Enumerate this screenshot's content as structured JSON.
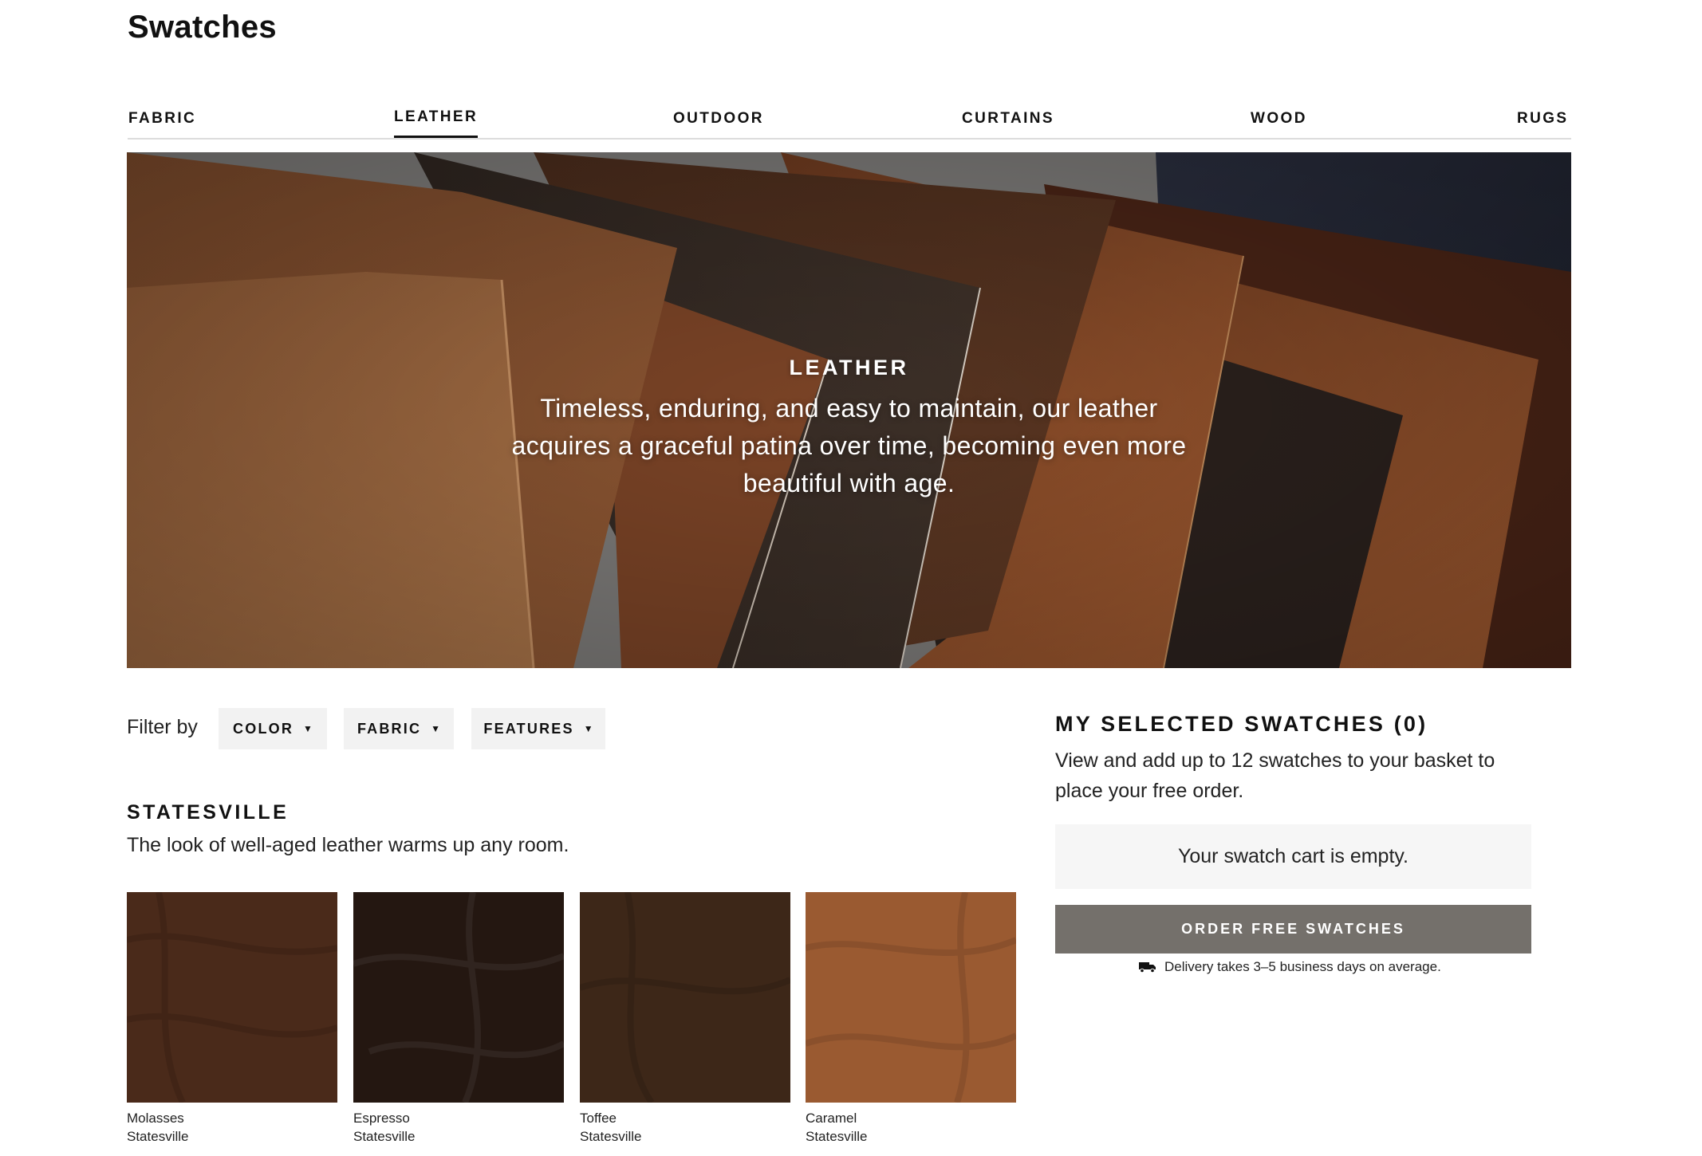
{
  "page": {
    "title": "Swatches"
  },
  "tabs": [
    {
      "label": "FABRIC",
      "active": false
    },
    {
      "label": "LEATHER",
      "active": true
    },
    {
      "label": "OUTDOOR",
      "active": false
    },
    {
      "label": "CURTAINS",
      "active": false
    },
    {
      "label": "WOOD",
      "active": false
    },
    {
      "label": "RUGS",
      "active": false
    }
  ],
  "hero": {
    "title": "LEATHER",
    "description": "Timeless, enduring, and easy to maintain, our leather acquires a graceful patina over time, becoming even more beautiful with age."
  },
  "filters": {
    "label": "Filter by",
    "options": [
      {
        "label": "COLOR",
        "icon": "caret-down-icon"
      },
      {
        "label": "FABRIC",
        "icon": "caret-down-icon"
      },
      {
        "label": "FEATURES",
        "icon": "caret-down-icon"
      }
    ]
  },
  "collection": {
    "title": "STATESVILLE",
    "description": "The look of well-aged leather warms up any room.",
    "swatches": [
      {
        "name": "Molasses",
        "collection": "Statesville",
        "color": "#4a2a1a"
      },
      {
        "name": "Espresso",
        "collection": "Statesville",
        "color": "#241711"
      },
      {
        "name": "Toffee",
        "collection": "Statesville",
        "color": "#3d2718"
      },
      {
        "name": "Caramel",
        "collection": "Statesville",
        "color": "#9a5a31"
      }
    ]
  },
  "selected": {
    "title": "MY SELECTED SWATCHES (0)",
    "description": "View and add up to 12 swatches to your basket to place your free order.",
    "empty_text": "Your swatch cart is empty.",
    "order_button": "ORDER FREE SWATCHES",
    "delivery_text": "Delivery takes 3–5 business days on average.",
    "delivery_icon": "truck-icon"
  },
  "colors": {
    "order_button_bg": "#74706b",
    "filter_bg": "#f2f2f2",
    "cart_bg": "#f6f6f6"
  }
}
